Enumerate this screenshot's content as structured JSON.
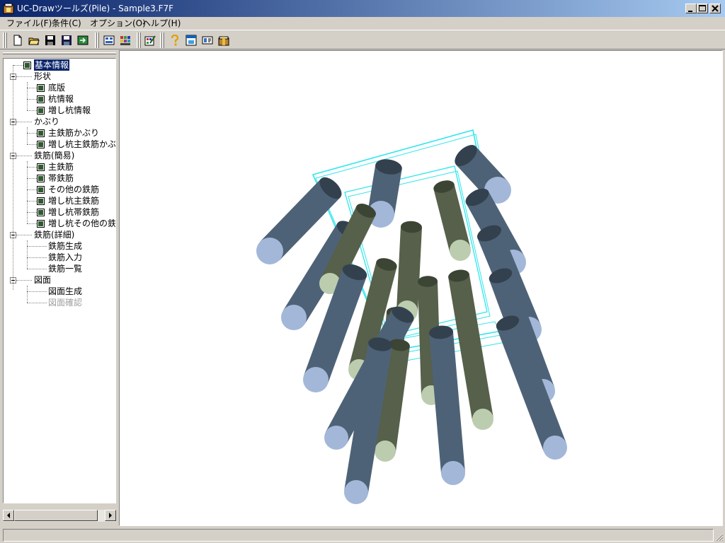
{
  "window": {
    "title": "UC-Drawツールズ(Pile) - Sample3.F7F"
  },
  "menu": [
    "ファイル(F)",
    "条件(C)",
    "オプション(O)",
    "ヘルプ(H)"
  ],
  "toolbar": [
    "new-file-icon",
    "open-folder-icon",
    "save-icon",
    "save-as-icon",
    "export-icon",
    "layout-icon",
    "grid-color-icon",
    "check-edit-icon",
    "help-icon",
    "window-icon",
    "card-icon",
    "gift-icon"
  ],
  "tree": {
    "root": {
      "label": "基本情報",
      "checked": true,
      "selected": true
    },
    "groups": [
      {
        "label": "形状",
        "children": [
          {
            "label": "底版",
            "checked": true
          },
          {
            "label": "杭情報",
            "checked": true
          },
          {
            "label": "増し杭情報",
            "checked": true
          }
        ]
      },
      {
        "label": "かぶり",
        "children": [
          {
            "label": "主鉄筋かぶり",
            "checked": true
          },
          {
            "label": "増し杭主鉄筋かぶり",
            "checked": true
          }
        ]
      },
      {
        "label": "鉄筋(簡易)",
        "children": [
          {
            "label": "主鉄筋",
            "checked": true
          },
          {
            "label": "帯鉄筋",
            "checked": true
          },
          {
            "label": "その他の鉄筋",
            "checked": true
          },
          {
            "label": "増し杭主鉄筋",
            "checked": true
          },
          {
            "label": "増し杭帯鉄筋",
            "checked": true
          },
          {
            "label": "増し杭その他の鉄筋",
            "checked": true
          }
        ]
      },
      {
        "label": "鉄筋(詳細)",
        "children": [
          {
            "label": "鉄筋生成"
          },
          {
            "label": "鉄筋入力"
          },
          {
            "label": "鉄筋一覧"
          }
        ]
      },
      {
        "label": "図面",
        "children": [
          {
            "label": "図面生成"
          },
          {
            "label": "図面確認",
            "disabled": true
          }
        ]
      }
    ]
  },
  "colors": {
    "accent": "#0a246a",
    "pile_blue": "#4e6277",
    "pile_blue_end": "#a3b7d9",
    "pile_green": "#56604a",
    "pile_green_end": "#bccdaf",
    "cyan_frame": "#2ee6ec",
    "checkbox": "#2e5a2e"
  }
}
